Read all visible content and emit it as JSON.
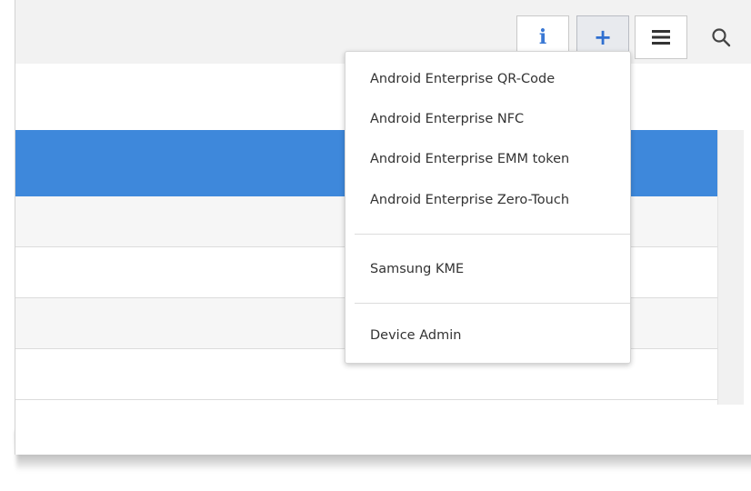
{
  "toolbar": {
    "buttons": [
      {
        "icon": "info-icon",
        "glyph": "i"
      },
      {
        "icon": "plus-icon",
        "glyph": "+"
      },
      {
        "icon": "hamburger-menu-icon"
      },
      {
        "icon": "search-icon"
      }
    ]
  },
  "dropdown": {
    "items": [
      "Android Enterprise QR-Code",
      "Android Enterprise NFC",
      "Android Enterprise EMM token",
      "Android Enterprise Zero-Touch",
      "Samsung KME",
      "Device Admin"
    ]
  },
  "colors": {
    "accent": "#3e88db",
    "toolbar_bg": "#f2f2f2",
    "icon_blue": "#2f6fd0"
  }
}
